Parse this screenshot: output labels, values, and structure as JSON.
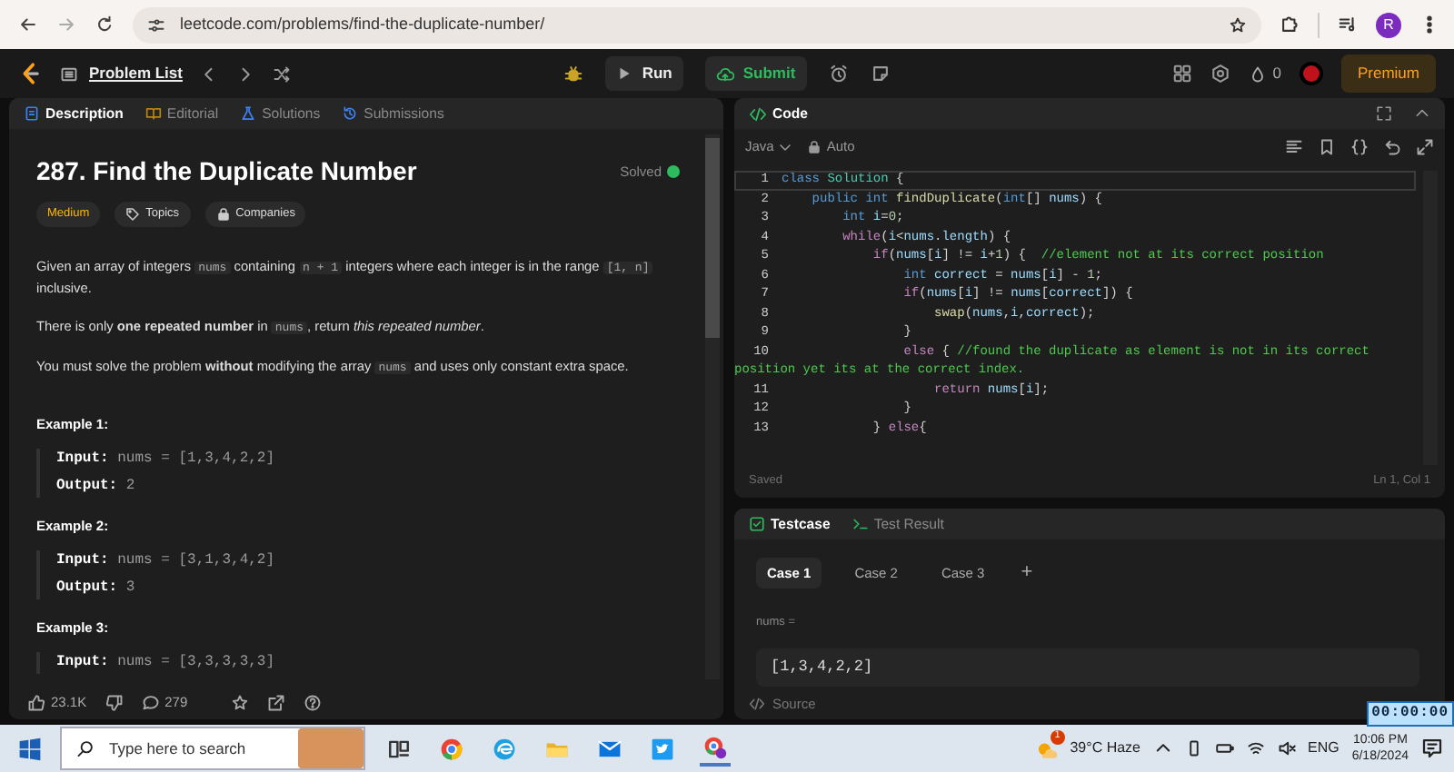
{
  "browser": {
    "url": "leetcode.com/problems/find-the-duplicate-number/",
    "profile_initial": "R"
  },
  "navbar": {
    "problem_list": "Problem List",
    "run": "Run",
    "submit": "Submit",
    "streak": "0",
    "premium": "Premium"
  },
  "description_panel": {
    "tabs": [
      {
        "label": "Description",
        "selected": true
      },
      {
        "label": "Editorial",
        "selected": false
      },
      {
        "label": "Solutions",
        "selected": false
      },
      {
        "label": "Submissions",
        "selected": false
      }
    ],
    "title": "287. Find the Duplicate Number",
    "status": "Solved",
    "solved": true,
    "difficulty": "Medium",
    "tags": [
      "Topics",
      "Companies"
    ],
    "paragraphs": [
      [
        {
          "kind": "text",
          "text": "Given an array of integers "
        },
        {
          "kind": "code",
          "text": "nums"
        },
        {
          "kind": "text",
          "text": " containing "
        },
        {
          "kind": "code",
          "text": "n + 1"
        },
        {
          "kind": "text",
          "text": " integers where each integer is in the range "
        },
        {
          "kind": "code",
          "text": "[1, n]"
        },
        {
          "kind": "text",
          "text": " inclusive."
        }
      ],
      [
        {
          "kind": "text",
          "text": "There is only **one repeated number** in "
        },
        {
          "kind": "code",
          "text": "nums"
        },
        {
          "kind": "text",
          "text": ", return *this repeated number*."
        }
      ],
      [
        {
          "kind": "text",
          "text": "You must solve the problem **without** modifying the array "
        },
        {
          "kind": "code",
          "text": "nums"
        },
        {
          "kind": "text",
          "text": " and uses only constant extra space."
        }
      ]
    ],
    "examples": [
      {
        "title": "Example 1:",
        "input_label": "Input:",
        "input": "nums = [1,3,4,2,2]",
        "output_label": "Output:",
        "output": "2"
      },
      {
        "title": "Example 2:",
        "input_label": "Input:",
        "input": "nums = [3,1,3,4,2]",
        "output_label": "Output:",
        "output": "3"
      },
      {
        "title": "Example 3:",
        "input_label": "Input:",
        "input": "nums = [3,3,3,3,3]"
      }
    ],
    "likes": "23.1K",
    "comments": "279"
  },
  "code_panel": {
    "title": "Code",
    "language": "Java",
    "mode": "Auto",
    "lines": [
      {
        "number": "1",
        "active": true,
        "segments": [
          {
            "kind": "kw",
            "text": "class"
          },
          {
            "kind": "type",
            "text": " Solution"
          },
          {
            "kind": "plain",
            "text": " {"
          }
        ]
      },
      {
        "number": "2",
        "active": false,
        "segments": [
          {
            "kind": "kw",
            "text": "    public"
          },
          {
            "kind": "kw",
            "text": " int"
          },
          {
            "kind": "fn",
            "text": " findDuplicate"
          },
          {
            "kind": "plain",
            "text": "("
          },
          {
            "kind": "kw",
            "text": "int"
          },
          {
            "kind": "plain",
            "text": "[] "
          },
          {
            "kind": "var",
            "text": "nums"
          },
          {
            "kind": "plain",
            "text": ") {"
          }
        ]
      },
      {
        "number": "3",
        "active": false,
        "segments": [
          {
            "kind": "kw",
            "text": "        int"
          },
          {
            "kind": "var",
            "text": " i"
          },
          {
            "kind": "plain",
            "text": "="
          },
          {
            "kind": "num",
            "text": "0"
          },
          {
            "kind": "plain",
            "text": ";"
          }
        ]
      },
      {
        "number": "4",
        "active": false,
        "segments": [
          {
            "kind": "ctrl",
            "text": "        while"
          },
          {
            "kind": "plain",
            "text": "("
          },
          {
            "kind": "var",
            "text": "i"
          },
          {
            "kind": "plain",
            "text": "<"
          },
          {
            "kind": "var",
            "text": "nums"
          },
          {
            "kind": "plain",
            "text": "."
          },
          {
            "kind": "var",
            "text": "length"
          },
          {
            "kind": "plain",
            "text": ") {"
          }
        ]
      },
      {
        "number": "5",
        "active": false,
        "segments": [
          {
            "kind": "ctrl",
            "text": "            if"
          },
          {
            "kind": "plain",
            "text": "("
          },
          {
            "kind": "var",
            "text": "nums"
          },
          {
            "kind": "plain",
            "text": "["
          },
          {
            "kind": "var",
            "text": "i"
          },
          {
            "kind": "plain",
            "text": "] != "
          },
          {
            "kind": "var",
            "text": "i"
          },
          {
            "kind": "plain",
            "text": "+"
          },
          {
            "kind": "num",
            "text": "1"
          },
          {
            "kind": "plain",
            "text": ") {  "
          },
          {
            "kind": "comment",
            "text": "//element not at its correct position"
          }
        ]
      },
      {
        "number": "6",
        "active": false,
        "segments": [
          {
            "kind": "kw",
            "text": "                int"
          },
          {
            "kind": "var",
            "text": " correct"
          },
          {
            "kind": "plain",
            "text": " = "
          },
          {
            "kind": "var",
            "text": "nums"
          },
          {
            "kind": "plain",
            "text": "["
          },
          {
            "kind": "var",
            "text": "i"
          },
          {
            "kind": "plain",
            "text": "] - "
          },
          {
            "kind": "num",
            "text": "1"
          },
          {
            "kind": "plain",
            "text": ";"
          }
        ]
      },
      {
        "number": "7",
        "active": false,
        "segments": [
          {
            "kind": "ctrl",
            "text": "                if"
          },
          {
            "kind": "plain",
            "text": "("
          },
          {
            "kind": "var",
            "text": "nums"
          },
          {
            "kind": "plain",
            "text": "["
          },
          {
            "kind": "var",
            "text": "i"
          },
          {
            "kind": "plain",
            "text": "] != "
          },
          {
            "kind": "var",
            "text": "nums"
          },
          {
            "kind": "plain",
            "text": "["
          },
          {
            "kind": "var",
            "text": "correct"
          },
          {
            "kind": "plain",
            "text": "]) {"
          }
        ]
      },
      {
        "number": "8",
        "active": false,
        "segments": [
          {
            "kind": "fn",
            "text": "                    swap"
          },
          {
            "kind": "plain",
            "text": "("
          },
          {
            "kind": "var",
            "text": "nums"
          },
          {
            "kind": "plain",
            "text": ","
          },
          {
            "kind": "var",
            "text": "i"
          },
          {
            "kind": "plain",
            "text": ","
          },
          {
            "kind": "var",
            "text": "correct"
          },
          {
            "kind": "plain",
            "text": ");"
          }
        ]
      },
      {
        "number": "9",
        "active": false,
        "segments": [
          {
            "kind": "plain",
            "text": "                }"
          }
        ]
      },
      {
        "number": "10",
        "active": false,
        "segments": [
          {
            "kind": "ctrl",
            "text": "                else"
          },
          {
            "kind": "plain",
            "text": " { "
          },
          {
            "kind": "comment",
            "text": "//found the duplicate as element is not in its correct"
          }
        ],
        "wrap": [
          {
            "kind": "comment",
            "text": "position yet its at the correct index."
          }
        ]
      },
      {
        "number": "11",
        "active": false,
        "segments": [
          {
            "kind": "ctrl",
            "text": "                    return"
          },
          {
            "kind": "var",
            "text": " nums"
          },
          {
            "kind": "plain",
            "text": "["
          },
          {
            "kind": "var",
            "text": "i"
          },
          {
            "kind": "plain",
            "text": "];"
          }
        ]
      },
      {
        "number": "12",
        "active": false,
        "segments": [
          {
            "kind": "plain",
            "text": "                }"
          }
        ]
      },
      {
        "number": "13",
        "active": false,
        "segments": [
          {
            "kind": "plain",
            "text": "            } "
          },
          {
            "kind": "ctrl",
            "text": "else"
          },
          {
            "kind": "plain",
            "text": "{"
          }
        ]
      }
    ],
    "save_status": "Saved",
    "cursor": "Ln 1, Col 1"
  },
  "testcase_panel": {
    "tabs": [
      {
        "label": "Testcase",
        "selected": true
      },
      {
        "label": "Test Result",
        "selected": false
      }
    ],
    "cases": [
      {
        "label": "Case 1",
        "selected": true
      },
      {
        "label": "Case 2",
        "selected": false
      },
      {
        "label": "Case 3",
        "selected": false
      }
    ],
    "add": "+",
    "param": "nums =",
    "value": "[1,3,4,2,2]",
    "source": "Source"
  },
  "timer": "00:00:00",
  "taskbar": {
    "search_placeholder": "Type here to search",
    "weather_alerts": "1",
    "weather": "39°C  Haze",
    "language": "ENG",
    "time": "10:06 PM",
    "date": "6/18/2024"
  }
}
